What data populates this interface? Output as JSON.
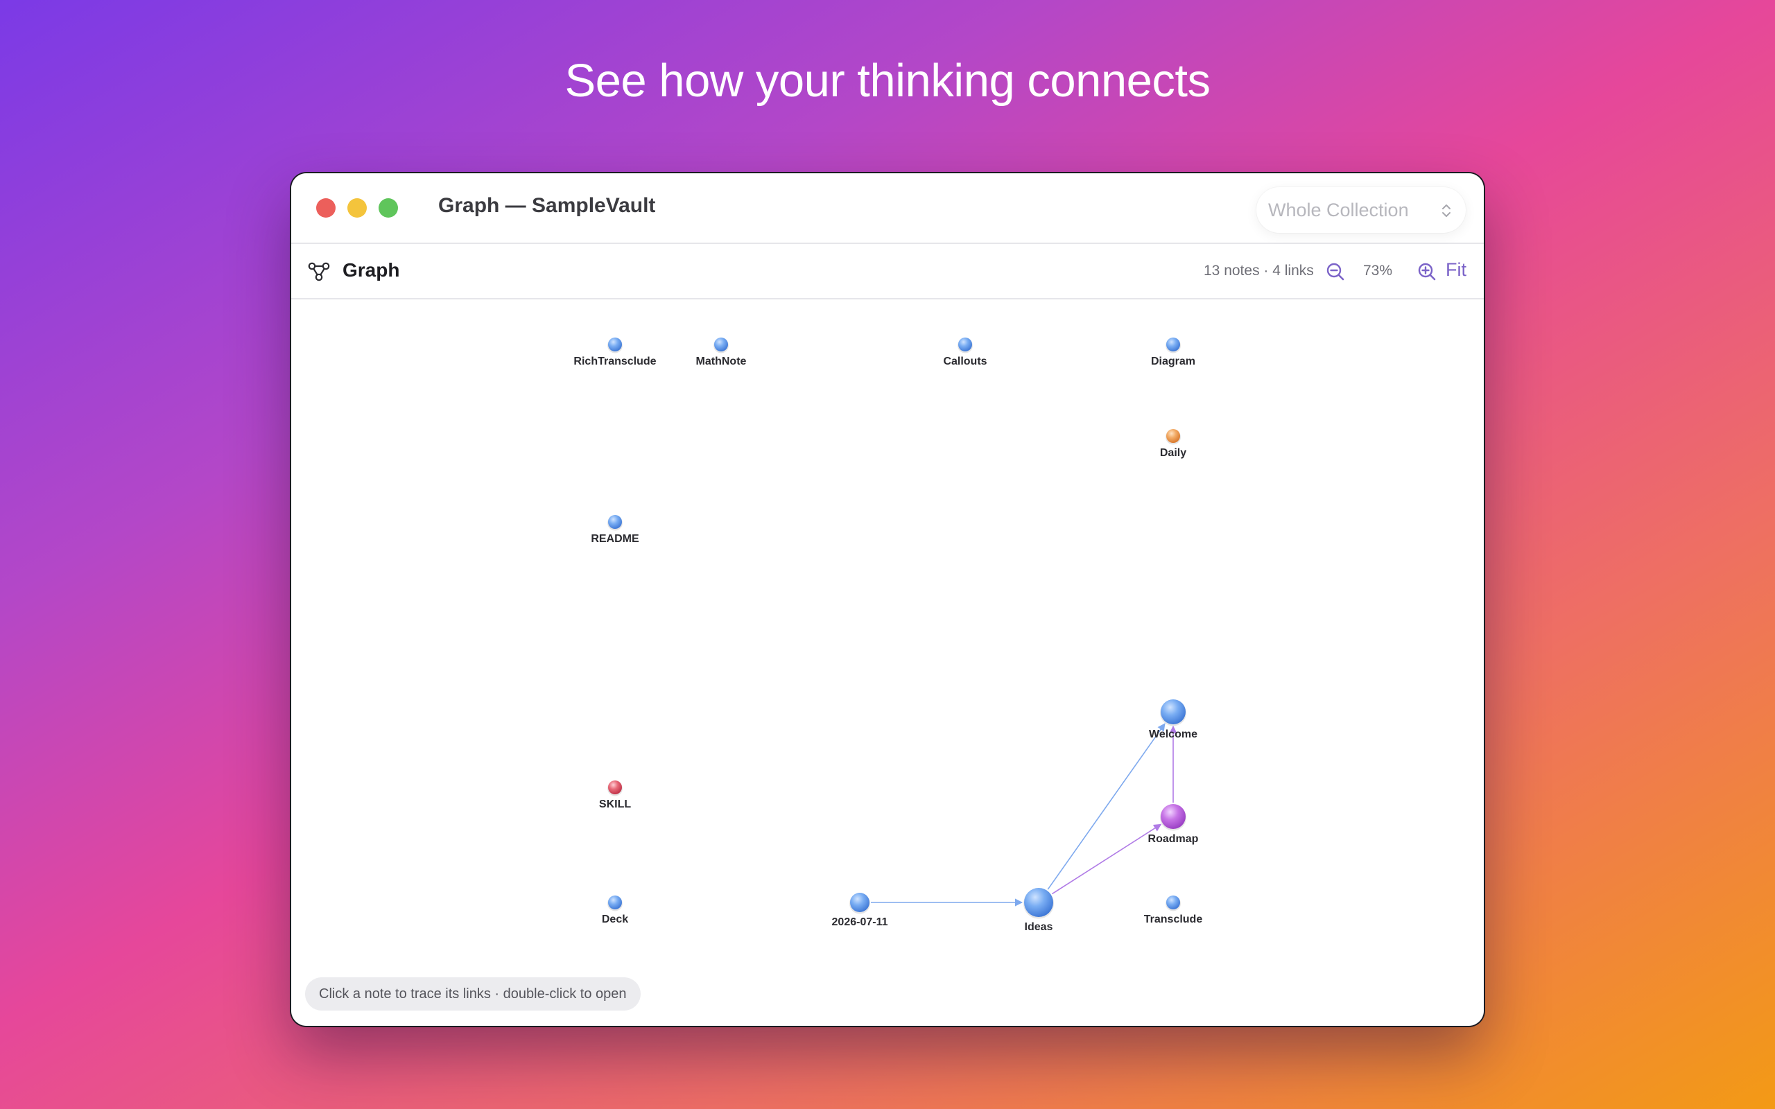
{
  "headline": "See how your thinking connects",
  "window": {
    "title": "Graph — SampleVault",
    "scope_select": {
      "selected": "Whole Collection"
    }
  },
  "toolbar": {
    "icon": "graph-icon",
    "title": "Graph",
    "stats": "13 notes · 4 links",
    "zoom_out_icon": "zoom-out-icon",
    "zoom_level": "73%",
    "zoom_in_icon": "zoom-in-icon",
    "fit_label": "Fit"
  },
  "graph": {
    "nodes": [
      {
        "label": "RichTransclude",
        "color": "blue"
      },
      {
        "label": "MathNote",
        "color": "blue"
      },
      {
        "label": "Callouts",
        "color": "blue"
      },
      {
        "label": "Diagram",
        "color": "blue"
      },
      {
        "label": "Daily",
        "color": "orange"
      },
      {
        "label": "README",
        "color": "blue"
      },
      {
        "label": "Welcome",
        "color": "blue"
      },
      {
        "label": "SKILL",
        "color": "red"
      },
      {
        "label": "Roadmap",
        "color": "purple"
      },
      {
        "label": "Deck",
        "color": "blue"
      },
      {
        "label": "2026-07-11",
        "color": "blue"
      },
      {
        "label": "Ideas",
        "color": "blue"
      },
      {
        "label": "Transclude",
        "color": "blue"
      }
    ],
    "links": [
      {
        "from": "2026-07-11",
        "to": "Ideas"
      },
      {
        "from": "Ideas",
        "to": "Welcome"
      },
      {
        "from": "Ideas",
        "to": "Roadmap"
      },
      {
        "from": "Roadmap",
        "to": "Welcome"
      }
    ]
  },
  "hint": "Click a note to trace its links · double-click to open",
  "colors": {
    "accent": "#7b63c8",
    "node_blue": "#6ea8f2",
    "node_orange": "#f0a25c",
    "node_red": "#e4606f",
    "node_purple": "#c06ae0"
  }
}
